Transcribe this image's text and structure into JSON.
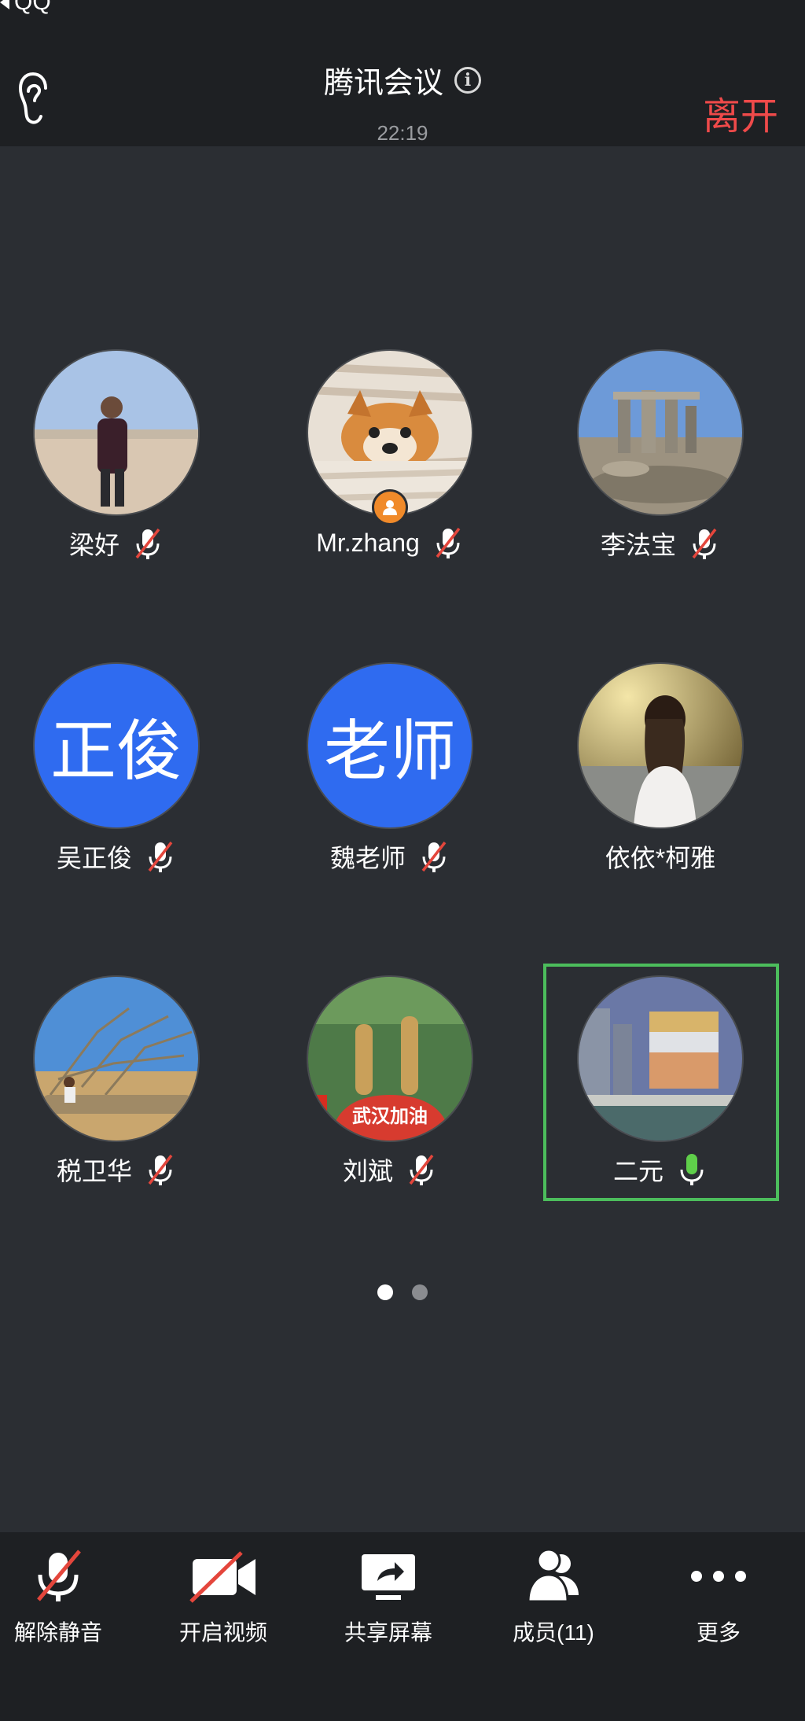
{
  "status": {
    "back_app": "QQ"
  },
  "header": {
    "title": "腾讯会议",
    "time": "22:19",
    "leave": "离开"
  },
  "participants": [
    {
      "name": "梁好",
      "mic": "muted",
      "avatar": "photo-man-beach"
    },
    {
      "name": "Mr.zhang",
      "mic": "muted",
      "avatar": "photo-shiba-dog",
      "host": true
    },
    {
      "name": "李法宝",
      "mic": "muted",
      "avatar": "photo-ruins"
    },
    {
      "name": "吴正俊",
      "mic": "muted",
      "avatar_text": "正俊"
    },
    {
      "name": "魏老师",
      "mic": "muted",
      "avatar_text": "老师"
    },
    {
      "name": "依依*柯雅",
      "mic": "none",
      "avatar": "photo-woman-dress"
    },
    {
      "name": "税卫华",
      "mic": "muted",
      "avatar": "photo-fallen-tree"
    },
    {
      "name": "刘斌",
      "mic": "muted",
      "avatar": "photo-wuhan-jiayou",
      "avatar_caption": "武汉加油"
    },
    {
      "name": "二元",
      "mic": "active",
      "avatar": "photo-city-building",
      "speaking": true
    }
  ],
  "pager": {
    "pages": 2,
    "current": 1
  },
  "toolbar": {
    "unmute": "解除静音",
    "video": "开启视频",
    "share": "共享屏幕",
    "members": "成员(11)",
    "more": "更多"
  },
  "colors": {
    "accent_red": "#ef4a4a",
    "speaking_green": "#4cbd5c",
    "avatar_blue": "#2f6bf0",
    "host_orange": "#f08a2a"
  }
}
